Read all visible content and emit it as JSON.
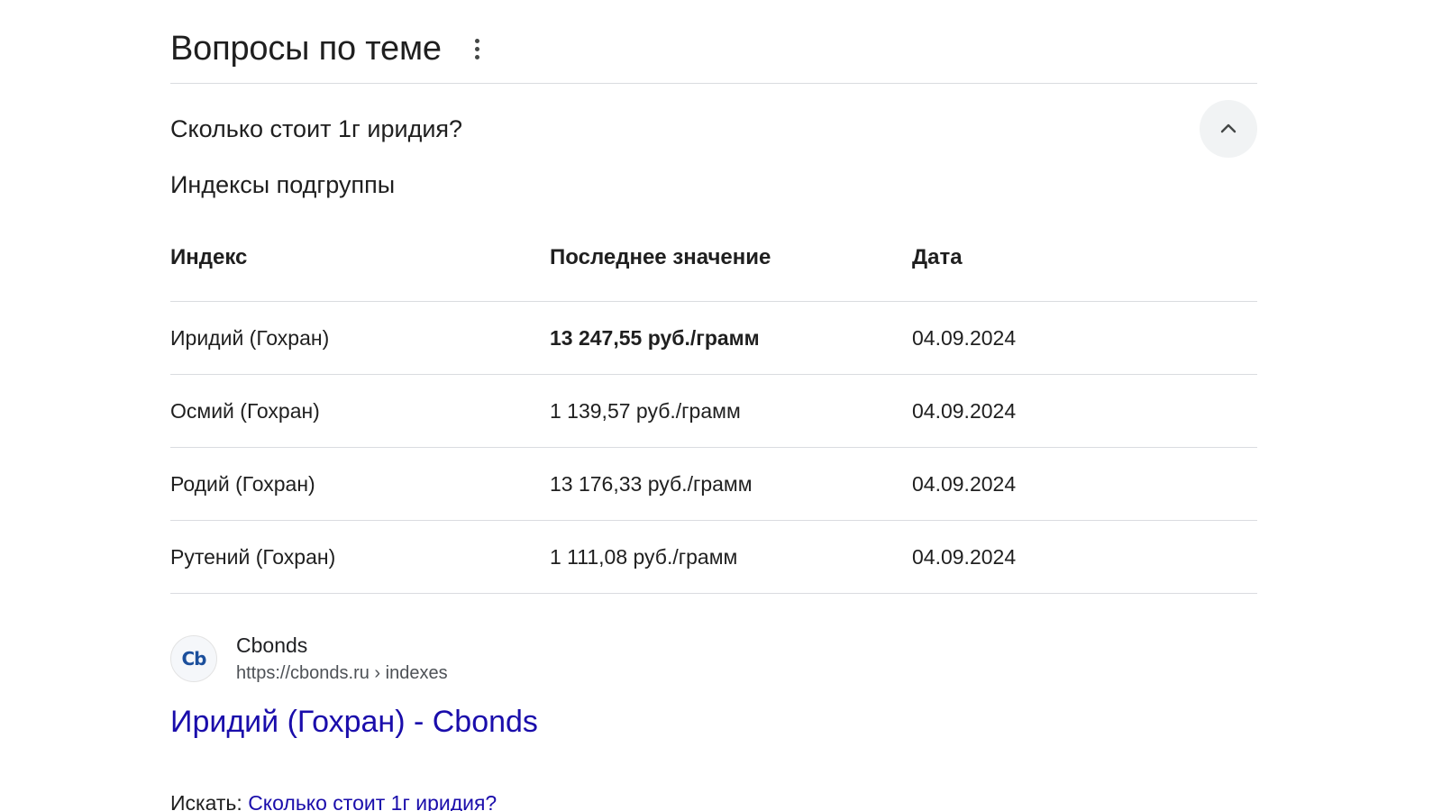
{
  "header": {
    "title": "Вопросы по теме"
  },
  "question": {
    "text": "Сколько стоит 1г иридия?"
  },
  "subheading": "Индексы подгруппы",
  "table": {
    "headers": [
      "Индекс",
      "Последнее значение",
      "Дата"
    ],
    "rows": [
      [
        "Иридий (Гохран)",
        "13 247,55 руб./грамм",
        "04.09.2024"
      ],
      [
        "Осмий (Гохран)",
        "1 139,57 руб./грамм",
        "04.09.2024"
      ],
      [
        "Родий (Гохран)",
        "13 176,33 руб./грамм",
        "04.09.2024"
      ],
      [
        "Рутений (Гохран)",
        "1 111,08 руб./грамм",
        "04.09.2024"
      ]
    ]
  },
  "source": {
    "favicon_text": "Cb",
    "name": "Cbonds",
    "url": "https://cbonds.ru › indexes"
  },
  "result": {
    "title": "Иридий (Гохран) - Cbonds"
  },
  "search": {
    "label": "Искать:",
    "query": "Сколько стоит 1г иридия?"
  },
  "colors": {
    "link": "#1a0dab",
    "text": "#1f1f1f",
    "divider": "#dadce0",
    "button_bg": "#f1f3f4"
  }
}
